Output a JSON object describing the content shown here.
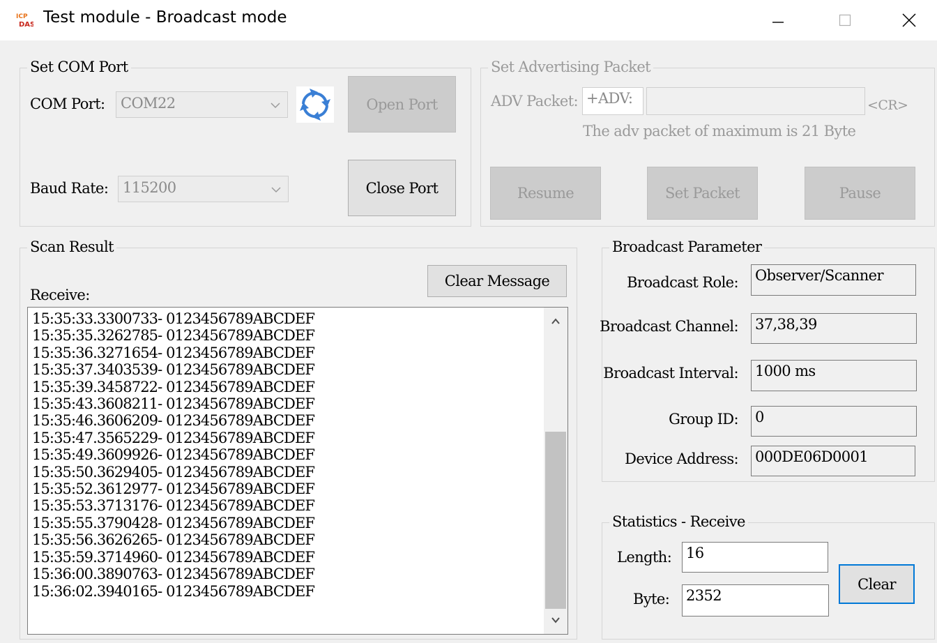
{
  "window": {
    "title": "Test module - Broadcast mode",
    "app_icon": "icpdas-logo-icon"
  },
  "com_port_group": {
    "title": "Set COM Port",
    "com_port_label": "COM Port:",
    "com_port_value": "COM22",
    "baud_rate_label": "Baud Rate:",
    "baud_rate_value": "115200",
    "refresh_icon": "refresh-icon",
    "open_port_label": "Open Port",
    "close_port_label": "Close Port"
  },
  "adv_group": {
    "title": "Set Advertising Packet",
    "adv_packet_label": "ADV Packet:",
    "adv_prefix": "+ADV:",
    "adv_value": "",
    "cr_label": "<CR>",
    "hint": "The adv packet of maximum is 21 Byte",
    "resume_label": "Resume",
    "set_packet_label": "Set Packet",
    "pause_label": "Pause"
  },
  "scan_group": {
    "title": "Scan Result",
    "clear_message_label": "Clear Message",
    "receive_label": "Receive:",
    "lines": [
      "15:35:33.3300733- 0123456789ABCDEF",
      "15:35:35.3262785- 0123456789ABCDEF",
      "15:35:36.3271654- 0123456789ABCDEF",
      "15:35:37.3403539- 0123456789ABCDEF",
      "15:35:39.3458722- 0123456789ABCDEF",
      "15:35:43.3608211- 0123456789ABCDEF",
      "15:35:46.3606209- 0123456789ABCDEF",
      "15:35:47.3565229- 0123456789ABCDEF",
      "15:35:49.3609926- 0123456789ABCDEF",
      "15:35:50.3629405- 0123456789ABCDEF",
      "15:35:52.3612977- 0123456789ABCDEF",
      "15:35:53.3713176- 0123456789ABCDEF",
      "15:35:55.3790428- 0123456789ABCDEF",
      "15:35:56.3626265- 0123456789ABCDEF",
      "15:35:59.3714960- 0123456789ABCDEF",
      "15:36:00.3890763- 0123456789ABCDEF",
      "15:36:02.3940165- 0123456789ABCDEF"
    ]
  },
  "broadcast_group": {
    "title": "Broadcast Parameter",
    "role_label": "Broadcast Role:",
    "role_value": "Observer/Scanner",
    "channel_label": "Broadcast Channel:",
    "channel_value": "37,38,39",
    "interval_label": "Broadcast Interval:",
    "interval_value": "1000 ms",
    "group_id_label": "Group ID:",
    "group_id_value": "0",
    "device_address_label": "Device Address:",
    "device_address_value": "000DE06D0001"
  },
  "stats_group": {
    "title": "Statistics - Receive",
    "length_label": "Length:",
    "length_value": "16",
    "byte_label": "Byte:",
    "byte_value": "2352",
    "clear_label": "Clear"
  },
  "colors": {
    "focus_accent": "#0078d7",
    "refresh_icon": "#3a7fd5"
  }
}
